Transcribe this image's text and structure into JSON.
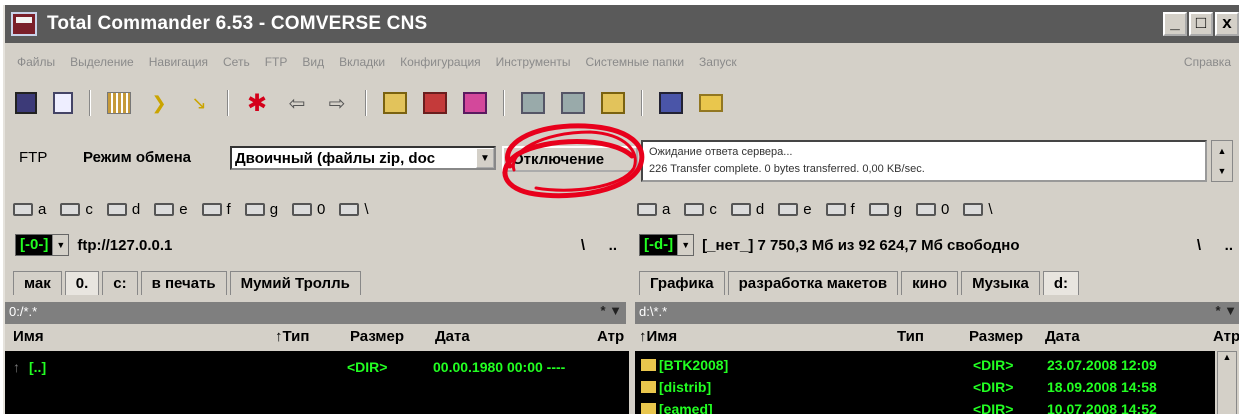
{
  "window": {
    "title": "Total Commander 6.53 - COMVERSE CNS",
    "controls": [
      "_",
      "□",
      "x"
    ]
  },
  "menu": {
    "items": [
      "Файлы",
      "Выделение",
      "Навигация",
      "Сеть",
      "FTP",
      "Вид",
      "Вкладки",
      "Конфигурация",
      "Инструменты",
      "Системные папки",
      "Запуск"
    ],
    "help": "Справка"
  },
  "toolbar_icons": [
    "floppy-icon",
    "document-icon",
    "grid-icon",
    "file-icon",
    "file-icon",
    "star-icon",
    "arrow-left-icon",
    "arrow-right-icon",
    "package-icon",
    "compare-icon",
    "sync-icon",
    "copy-icon",
    "tools-icon",
    "network-icon",
    "ftp-icon",
    "folder-icon"
  ],
  "ftp": {
    "label": "FTP",
    "mode_label": "Режим обмена",
    "mode_value": "Двоичный (файлы zip, doc",
    "disconnect": "Отключение",
    "log": [
      "Ожидание ответа сервера...",
      "226 Transfer complete. 0 bytes transferred. 0,00 KB/sec."
    ]
  },
  "left": {
    "drives": [
      "a",
      "c",
      "d",
      "e",
      "f",
      "g",
      "0",
      "\\"
    ],
    "drive_selected": "[-0-]",
    "path": "ftp://127.0.0.1",
    "root_btn": "\\",
    "up_btn": "..",
    "tabs": [
      "мак",
      "0.",
      "c:",
      "в печать",
      "Мумий Тролль"
    ],
    "filter": "0:/*.*",
    "filter_btns": "* ▼",
    "columns": {
      "name": "Имя",
      "type": "↑Тип",
      "size": "Размер",
      "date": "Дата",
      "attr": "Атр"
    },
    "rows": [
      {
        "icon": "↑",
        "name": "[..]",
        "size": "<DIR>",
        "date": "00.00.1980 00:00 ----"
      }
    ]
  },
  "right": {
    "drives": [
      "a",
      "c",
      "d",
      "e",
      "f",
      "g",
      "0",
      "\\"
    ],
    "drive_selected": "[-d-]",
    "status": "[_нет_]  7 750,3 Мб из 92 624,7 Мб свободно",
    "root_btn": "\\",
    "up_btn": "..",
    "tabs": [
      "Графика",
      "разработка макетов",
      "кино",
      "Музыка",
      "d:"
    ],
    "filter": "d:\\*.*",
    "filter_btns": "* ▼",
    "columns": {
      "name": "↑Имя",
      "type": "Тип",
      "size": "Размер",
      "date": "Дата",
      "attr": "Атр"
    },
    "rows": [
      {
        "name": "[BTK2008]",
        "size": "<DIR>",
        "date": "23.07.2008 12:09"
      },
      {
        "name": "[distrib]",
        "size": "<DIR>",
        "date": "18.09.2008 14:58"
      },
      {
        "name": "[eamed]",
        "size": "<DIR>",
        "date": "10.07.2008 14:52"
      }
    ]
  },
  "colors": {
    "titlebar": "#5a5a5a",
    "panel_bg": "#000000",
    "panel_text": "#22ff22",
    "annotation": "#e8001c"
  }
}
